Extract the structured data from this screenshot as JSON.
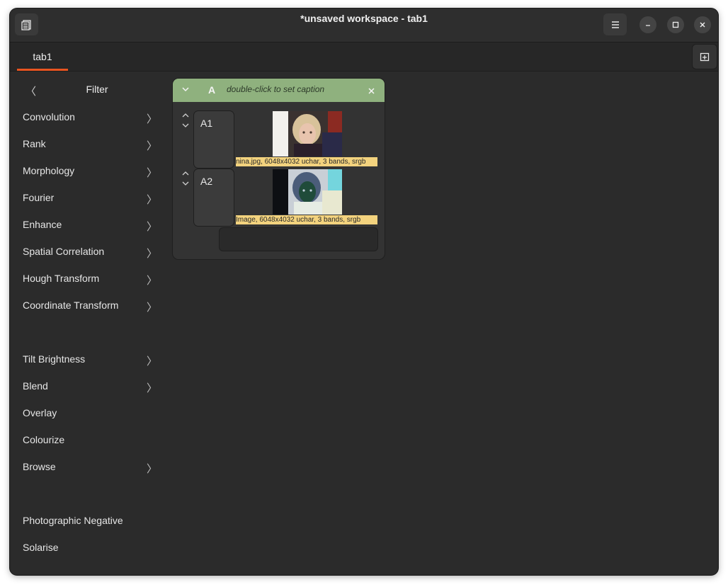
{
  "window": {
    "title": "*unsaved workspace - tab1",
    "icons": {
      "app_menu": "docs-icon",
      "hamburger": "hamburger-menu-icon",
      "minimize": "minimize-icon",
      "maximize": "maximize-icon",
      "close": "close-icon",
      "new_tab": "new-tab-icon"
    }
  },
  "tabs": [
    {
      "label": "tab1",
      "active": true
    }
  ],
  "sidebar": {
    "header": "Filter",
    "items": [
      {
        "label": "Convolution",
        "submenu": true
      },
      {
        "label": "Rank",
        "submenu": true
      },
      {
        "label": "Morphology",
        "submenu": true
      },
      {
        "label": "Fourier",
        "submenu": true
      },
      {
        "label": "Enhance",
        "submenu": true
      },
      {
        "label": "Spatial Correlation",
        "submenu": true
      },
      {
        "label": "Hough Transform",
        "submenu": true
      },
      {
        "label": "Coordinate Transform",
        "submenu": true
      },
      {
        "label": "Tilt Brightness",
        "submenu": true
      },
      {
        "label": "Blend",
        "submenu": true
      },
      {
        "label": "Overlay",
        "submenu": false
      },
      {
        "label": "Colourize",
        "submenu": false
      },
      {
        "label": "Browse",
        "submenu": true
      },
      {
        "label": "Photographic Negative",
        "submenu": false
      },
      {
        "label": "Solarise",
        "submenu": false
      }
    ]
  },
  "node": {
    "column_letter": "A",
    "caption_placeholder": "double-click to set caption",
    "rows": [
      {
        "name": "A1",
        "info": "nina.jpg, 6048x4032 uchar, 3 bands, srgb"
      },
      {
        "name": "A2",
        "info": "Image, 6048x4032 uchar, 3 bands, srgb"
      }
    ],
    "entry_value": ""
  },
  "colors": {
    "accent": "#e95420",
    "node_header": "#8fb17e",
    "info_label_bg": "#f3d37e",
    "window_bg": "#2b2b2b"
  }
}
